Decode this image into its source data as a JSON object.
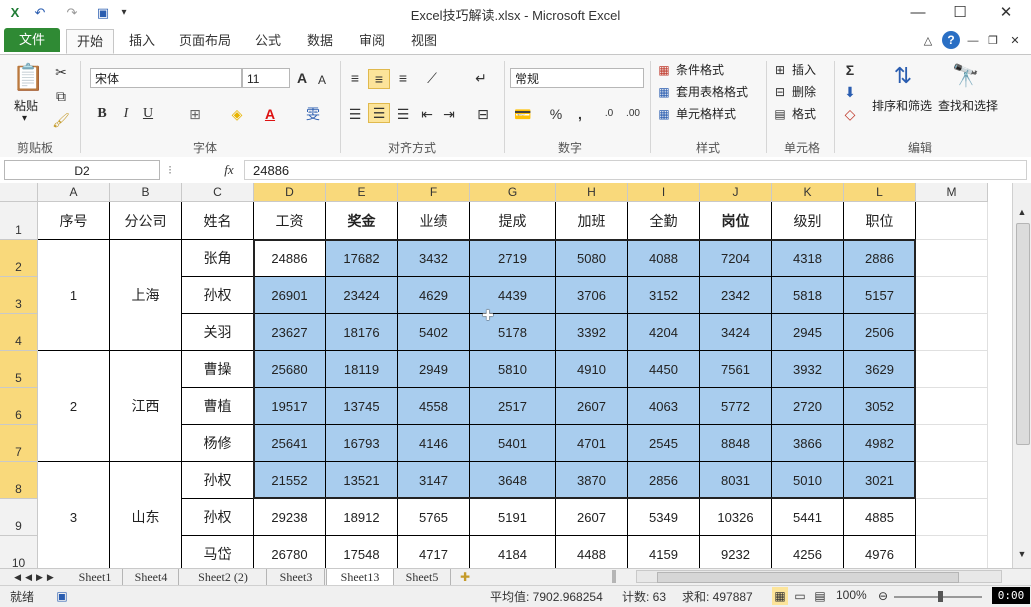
{
  "window": {
    "title": "Excel技巧解读.xlsx - Microsoft Excel",
    "minimize": "—",
    "restore": "☐",
    "close": "✕"
  },
  "ribbon_tabs": {
    "file": "文件",
    "tabs": [
      "开始",
      "插入",
      "页面布局",
      "公式",
      "数据",
      "审阅",
      "视图"
    ],
    "active": "开始"
  },
  "clipboard": {
    "paste": "粘贴",
    "label": "剪贴板"
  },
  "font": {
    "name": "宋体",
    "size": "11",
    "label": "字体",
    "bold": "B",
    "italic": "I",
    "underline": "U"
  },
  "alignment": {
    "label": "对齐方式"
  },
  "number": {
    "format": "常规",
    "label": "数字",
    "percent": "%",
    "comma": ","
  },
  "styles": {
    "conditional": "条件格式",
    "table": "套用表格格式",
    "cell": "单元格样式",
    "label": "样式"
  },
  "cells": {
    "insert": "插入",
    "delete": "删除",
    "format": "格式",
    "label": "单元格"
  },
  "editing": {
    "sort": "排序和筛选",
    "find": "查找和选择",
    "label": "编辑"
  },
  "formula_bar": {
    "name_box": "D2",
    "fx": "fx",
    "value": "24886"
  },
  "columns": [
    "A",
    "B",
    "C",
    "D",
    "E",
    "F",
    "G",
    "H",
    "I",
    "J",
    "K",
    "L",
    "M"
  ],
  "rows": [
    "1",
    "2",
    "3",
    "4",
    "5",
    "6",
    "7",
    "8",
    "9",
    "10"
  ],
  "headers": [
    "序号",
    "分公司",
    "姓名",
    "工资",
    "奖金",
    "业绩",
    "提成",
    "加班",
    "全勤",
    "岗位",
    "级别",
    "职位"
  ],
  "groups": [
    {
      "no": "1",
      "branch": "上海"
    },
    {
      "no": "2",
      "branch": "江西"
    },
    {
      "no": "3",
      "branch": "山东"
    }
  ],
  "data_rows": [
    {
      "name": "张角",
      "values": [
        "24886",
        "17682",
        "3432",
        "2719",
        "5080",
        "4088",
        "7204",
        "4318",
        "2886"
      ]
    },
    {
      "name": "孙权",
      "values": [
        "26901",
        "23424",
        "4629",
        "4439",
        "3706",
        "3152",
        "2342",
        "5818",
        "5157"
      ]
    },
    {
      "name": "关羽",
      "values": [
        "23627",
        "18176",
        "5402",
        "5178",
        "3392",
        "4204",
        "3424",
        "2945",
        "2506"
      ]
    },
    {
      "name": "曹操",
      "values": [
        "25680",
        "18119",
        "2949",
        "5810",
        "4910",
        "4450",
        "7561",
        "3932",
        "3629"
      ]
    },
    {
      "name": "曹植",
      "values": [
        "19517",
        "13745",
        "4558",
        "2517",
        "2607",
        "4063",
        "5772",
        "2720",
        "3052"
      ]
    },
    {
      "name": "杨修",
      "values": [
        "25641",
        "16793",
        "4146",
        "5401",
        "4701",
        "2545",
        "8848",
        "3866",
        "4982"
      ]
    },
    {
      "name": "孙权",
      "values": [
        "21552",
        "13521",
        "3147",
        "3648",
        "3870",
        "2856",
        "8031",
        "5010",
        "3021"
      ]
    },
    {
      "name": "孙权",
      "values": [
        "29238",
        "18912",
        "5765",
        "5191",
        "2607",
        "5349",
        "10326",
        "5441",
        "4885"
      ]
    },
    {
      "name": "马岱",
      "values": [
        "26780",
        "17548",
        "4717",
        "4184",
        "4488",
        "4159",
        "9232",
        "4256",
        "4976"
      ]
    }
  ],
  "sheets": [
    "Sheet1",
    "Sheet4",
    "Sheet2 (2)",
    "Sheet3",
    "Sheet13",
    "Sheet5"
  ],
  "active_sheet": "Sheet13",
  "status": {
    "mode": "就绪",
    "average": "平均值: 7902.968254",
    "count": "计数: 63",
    "sum": "求和: 497887",
    "zoom": "100%",
    "timer": "0:00"
  },
  "colors": {
    "selection": "#a9cdee",
    "header_selected": "#f9d97b",
    "file_tab": "#2f8a34"
  }
}
